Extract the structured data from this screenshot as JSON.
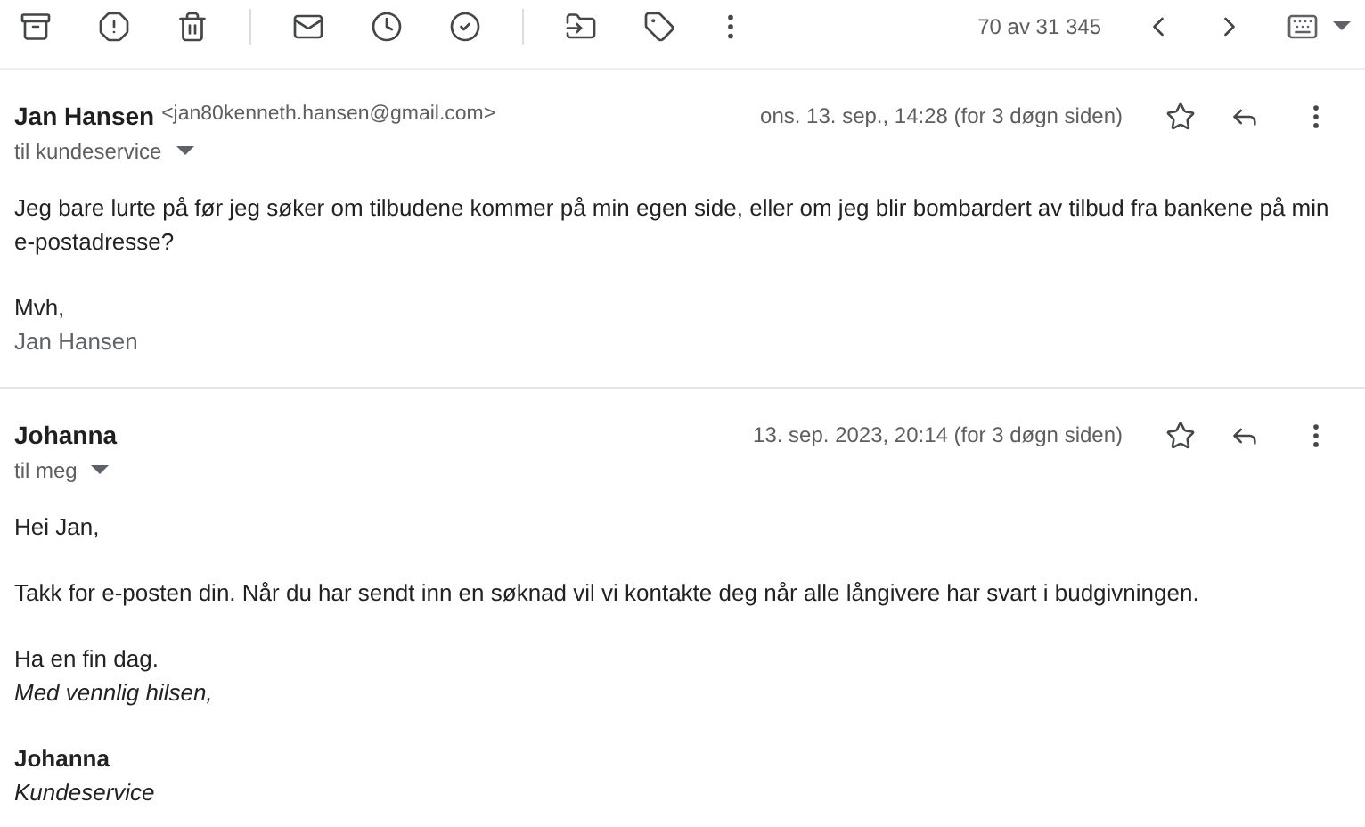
{
  "toolbar": {
    "counter": "70 av 31 345"
  },
  "messages": [
    {
      "sender": "Jan Hansen",
      "email": "<jan80kenneth.hansen@gmail.com>",
      "date": "ons. 13. sep., 14:28 (for 3 døgn siden)",
      "recipient": "til kundeservice",
      "starred": false,
      "paragraphs": [
        [
          {
            "kind": "plain",
            "text": "Jeg bare lurte på før jeg søker om tilbudene kommer på min egen side, eller om jeg blir bombardert av tilbud fra bankene på min e-postadresse?"
          }
        ],
        [
          {
            "kind": "plain",
            "text": "Mvh,"
          },
          {
            "kind": "muted",
            "text": "Jan Hansen"
          }
        ]
      ]
    },
    {
      "sender": "Johanna",
      "date": "13. sep. 2023, 20:14 (for 3 døgn siden)",
      "recipient": "til meg",
      "starred": false,
      "paragraphs": [
        [
          {
            "kind": "plain",
            "text": "Hei Jan,"
          }
        ],
        [
          {
            "kind": "plain",
            "text": "Takk for e-posten din. Når du har sendt inn en søknad vil vi kontakte deg når alle långivere har svart i budgivningen."
          }
        ],
        [
          {
            "kind": "plain",
            "text": "Ha en fin dag."
          },
          {
            "kind": "italic",
            "text": "Med vennlig hilsen,"
          }
        ],
        [
          {
            "kind": "bold",
            "text": "Johanna"
          },
          {
            "kind": "italic",
            "text": "Kundeservice"
          }
        ]
      ]
    }
  ]
}
